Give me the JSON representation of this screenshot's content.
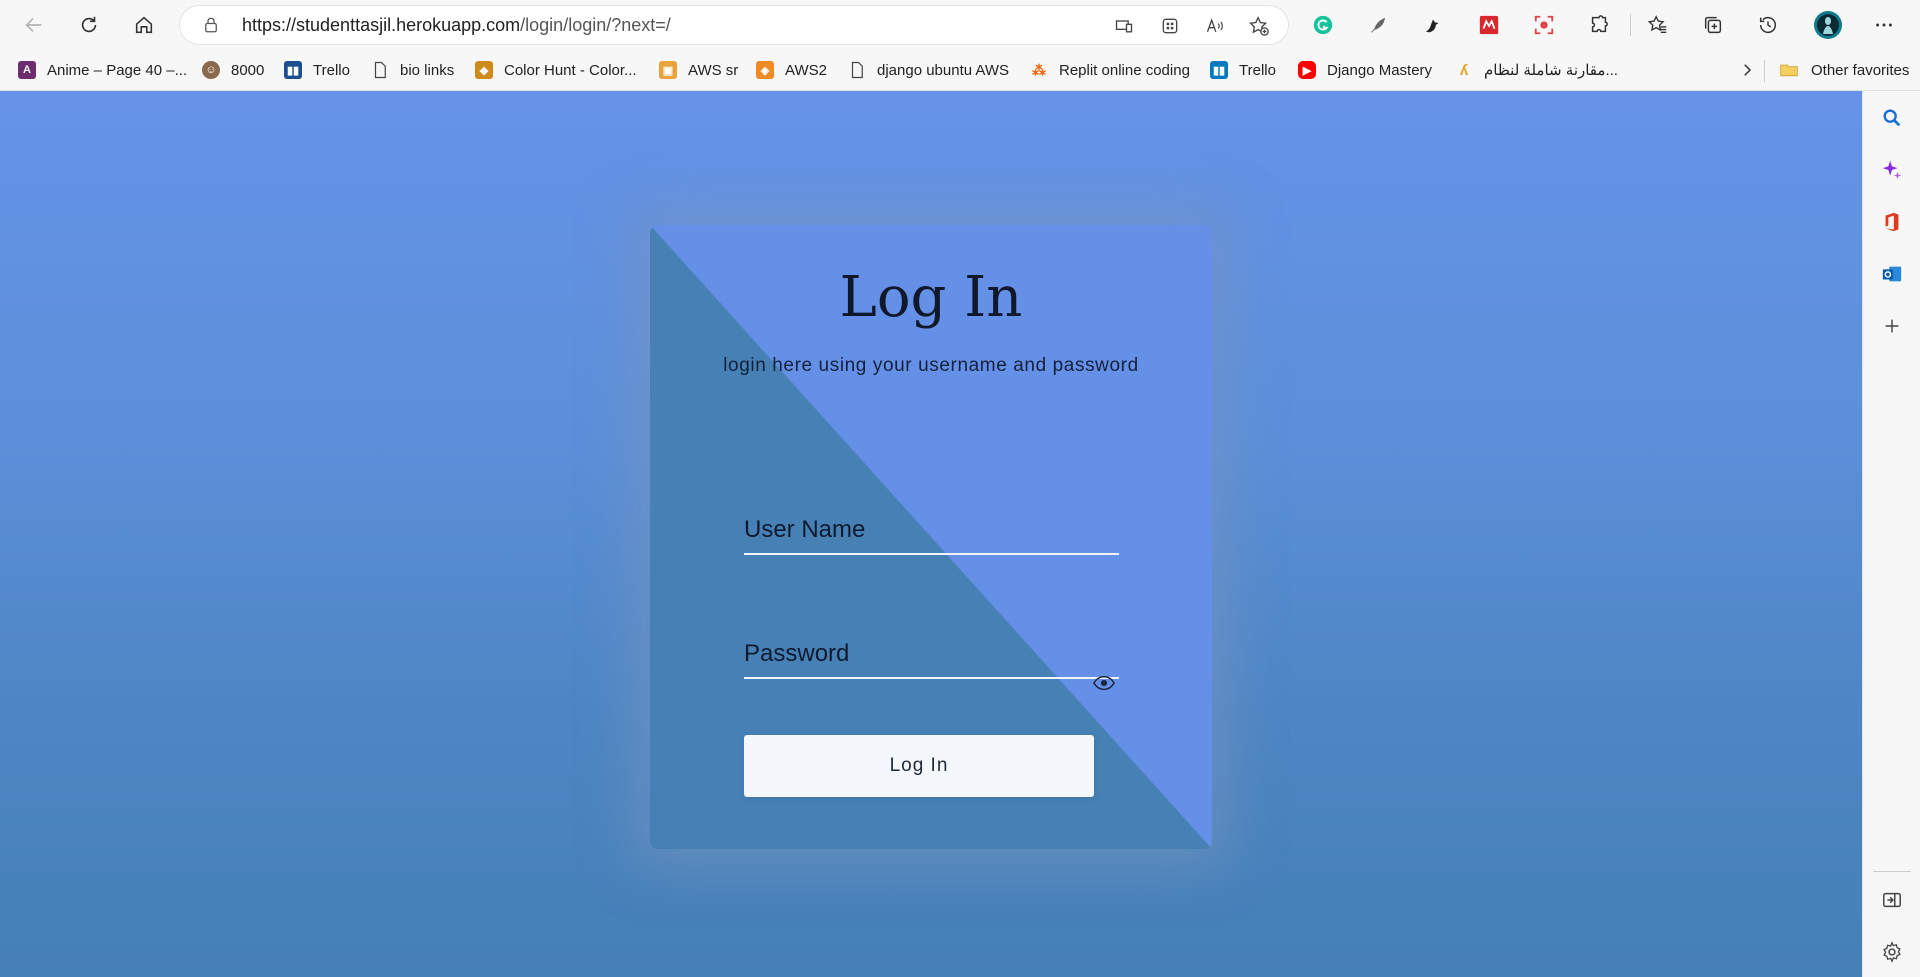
{
  "browser": {
    "url_host": "https://studenttasjil.herokuapp.com",
    "url_path": "/login/login/?next=/"
  },
  "favorites": [
    {
      "label": "Anime – Page 40 –...",
      "icon": "anime-favicon",
      "color": "#6b2d6e"
    },
    {
      "label": "8000",
      "icon": "user-favicon",
      "color": "#8a6a4a"
    },
    {
      "label": "Trello",
      "icon": "trello-favicon",
      "color": "#1d4e8f"
    },
    {
      "label": "bio links",
      "icon": "page-icon",
      "color": "#555555"
    },
    {
      "label": "Color Hunt - Color...",
      "icon": "colorhunt-favicon",
      "color": "#d08a1a"
    },
    {
      "label": "AWS sr",
      "icon": "aws-box-icon",
      "color": "#e8a33d"
    },
    {
      "label": "AWS2",
      "icon": "aws-cube-icon",
      "color": "#f08a24"
    },
    {
      "label": "django ubuntu AWS",
      "icon": "page-icon",
      "color": "#555555"
    },
    {
      "label": "Replit online coding",
      "icon": "replit-favicon",
      "color": "#f26207"
    },
    {
      "label": "Trello",
      "icon": "trello-favicon",
      "color": "#0079bf"
    },
    {
      "label": "Django Mastery",
      "icon": "youtube-favicon",
      "color": "#ff0000"
    },
    {
      "label": "مقارنة شاملة لنظام...",
      "icon": "arabic-site-favicon",
      "color": "#e8a020"
    }
  ],
  "other_favorites": "Other favorites",
  "login": {
    "title": "Log In",
    "subtitle": "login here using your username and password",
    "username_placeholder": "User Name",
    "password_placeholder": "Password",
    "button_label": "Log In"
  },
  "colors": {
    "page_top": "#6693e8",
    "page_bottom": "#4580b6",
    "card_dark": "#4680b4",
    "card_light": "#6590e8",
    "button_bg": "#f4f7fb"
  }
}
